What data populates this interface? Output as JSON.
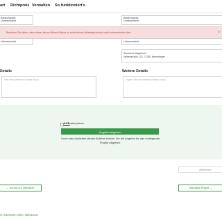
{
  "nav": {
    "items": [
      "art",
      "Richtpreis",
      "Verwalten",
      "So funktioniert's"
    ]
  },
  "left_fields": {
    "f1": "Befahrbarkeit",
    "f1_sub": "Unbeschränkt",
    "f2_sub": "Unbeschränkt"
  },
  "right_fields": {
    "f1": "Befahrbarkeit",
    "f1_sub": "Unbeschränkt",
    "f2_sub": "Unbeschränkt",
    "addr1": "Anneliese Allgäubort",
    "addr2": "Nebenstraße 122, 71282 Hemmingen"
  },
  "alert": {
    "text": "Beachten Sie daher, dass dieser die an Mineral-Minds zu entrichtende Mindestprovision nicht unterschreiten darf."
  },
  "details_left": {
    "title": "Details",
    "placeholder": "Hier Ihre weiteren Details hinzu..."
  },
  "details_right": {
    "title": "Weitere Details",
    "placeholder": "Fügen Sie hier weitere Details hinzu..."
  },
  "agb": {
    "link": "AGB",
    "suffix": "akzeptieren"
  },
  "submit_label": "Angebot abgeben",
  "note": "Durch das Anklicken dieses Buttons können Sie ein Angebot für das vorliegende Projekt abgeben.",
  "cancel_label": "Abbrechen",
  "back_label": "← Zurück zur Übersicht",
  "next_label": "Nächstes Projekt →",
  "footer": "ln • Impressum • AGB • Datenschutz",
  "colors": {
    "accent": "#3a9a4c",
    "alert_bg": "#f6dede",
    "alert_text": "#c0392b",
    "band_bg": "#eef7ef"
  }
}
